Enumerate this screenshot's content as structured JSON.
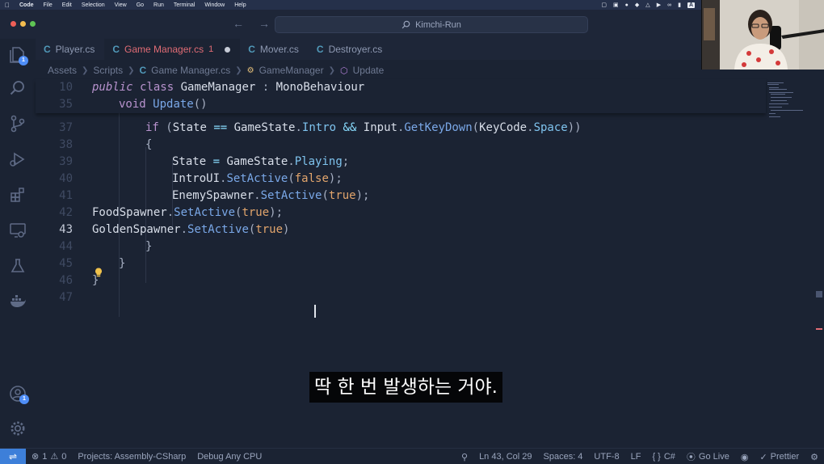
{
  "menubar": {
    "items": [
      "Code",
      "File",
      "Edit",
      "Selection",
      "View",
      "Go",
      "Run",
      "Terminal",
      "Window",
      "Help"
    ],
    "input_source": "A"
  },
  "titlebar": {
    "search_text": "Kimchi-Run"
  },
  "activity": {
    "explorer_badge": "1",
    "accounts_badge": "1"
  },
  "tabs": [
    {
      "label": "Player.cs",
      "icon": "C"
    },
    {
      "label": "Game Manager.cs",
      "icon": "C",
      "problems": "1"
    },
    {
      "label": "Mover.cs",
      "icon": "C"
    },
    {
      "label": "Destroyer.cs",
      "icon": "C"
    }
  ],
  "breadcrumbs": {
    "assets": "Assets",
    "scripts": "Scripts",
    "file": "Game Manager.cs",
    "class": "GameManager",
    "method": "Update"
  },
  "code": {
    "lines": [
      {
        "n": "10",
        "t": [
          [
            "kw",
            "public"
          ],
          [
            "ty",
            " "
          ],
          [
            "kw2",
            "class"
          ],
          [
            "ty",
            " GameManager "
          ],
          [
            "pn",
            ":"
          ],
          [
            "ty",
            " MonoBehaviour"
          ]
        ]
      },
      {
        "n": "35",
        "t": [
          [
            "kw2",
            "void"
          ],
          [
            "ty",
            " "
          ],
          [
            "fn",
            "Update"
          ],
          [
            "pn",
            "()"
          ]
        ]
      },
      {
        "n": "37",
        "t": [
          [
            "kw2",
            "if"
          ],
          [
            "ty",
            " "
          ],
          [
            "pn",
            "("
          ],
          [
            "ty",
            "State "
          ],
          [
            "op",
            "=="
          ],
          [
            "ty",
            " GameState"
          ],
          [
            "pn",
            "."
          ],
          [
            "pr",
            "Intro"
          ],
          [
            "ty",
            " "
          ],
          [
            "op",
            "&&"
          ],
          [
            "ty",
            " Input"
          ],
          [
            "pn",
            "."
          ],
          [
            "fn",
            "GetKeyDown"
          ],
          [
            "pn",
            "("
          ],
          [
            "ty",
            "KeyCode"
          ],
          [
            "pn",
            "."
          ],
          [
            "pr",
            "Space"
          ],
          [
            "pn",
            "))"
          ]
        ]
      },
      {
        "n": "38",
        "t": [
          [
            "pn",
            "{"
          ]
        ]
      },
      {
        "n": "39",
        "t": [
          [
            "ty",
            "State "
          ],
          [
            "op",
            "="
          ],
          [
            "ty",
            " GameState"
          ],
          [
            "pn",
            "."
          ],
          [
            "pr",
            "Playing"
          ],
          [
            "pn",
            ";"
          ]
        ]
      },
      {
        "n": "40",
        "t": [
          [
            "ty",
            "IntroUI"
          ],
          [
            "pn",
            "."
          ],
          [
            "fn",
            "SetActive"
          ],
          [
            "pn",
            "("
          ],
          [
            "bool",
            "false"
          ],
          [
            "pn",
            ");"
          ]
        ]
      },
      {
        "n": "41",
        "t": [
          [
            "ty",
            "EnemySpawner"
          ],
          [
            "pn",
            "."
          ],
          [
            "fn",
            "SetActive"
          ],
          [
            "pn",
            "("
          ],
          [
            "bool",
            "true"
          ],
          [
            "pn",
            ");"
          ]
        ]
      },
      {
        "n": "42",
        "t": [
          [
            "ty",
            "FoodSpawner"
          ],
          [
            "pn",
            "."
          ],
          [
            "fn",
            "SetActive"
          ],
          [
            "pn",
            "("
          ],
          [
            "bool",
            "true"
          ],
          [
            "pn",
            ");"
          ]
        ]
      },
      {
        "n": "43",
        "t": [
          [
            "ty",
            "GoldenSpawner"
          ],
          [
            "pn",
            "."
          ],
          [
            "fn",
            "SetActive"
          ],
          [
            "pn",
            "("
          ],
          [
            "bool",
            "true"
          ],
          [
            "pn",
            ")"
          ]
        ]
      },
      {
        "n": "44",
        "t": [
          [
            "pn",
            "}"
          ]
        ]
      },
      {
        "n": "45",
        "t": [
          [
            "pn",
            "}"
          ]
        ]
      },
      {
        "n": "46",
        "t": [
          [
            "pn",
            "}"
          ]
        ]
      },
      {
        "n": "47",
        "t": []
      }
    ]
  },
  "subtitle": "딱 한 번 발생하는 거야.",
  "statusbar": {
    "errors": "1",
    "warnings": "0",
    "project": "Projects: Assembly-CSharp",
    "debug": "Debug Any CPU",
    "position": "Ln 43, Col 29",
    "spaces": "Spaces: 4",
    "encoding": "UTF-8",
    "eol": "LF",
    "language": "C#",
    "golive": "Go Live",
    "prettier": "Prettier"
  },
  "colors": {
    "accent": "#3d7fd9",
    "background": "#1b2333",
    "active_tab_text": "#e06c75"
  }
}
